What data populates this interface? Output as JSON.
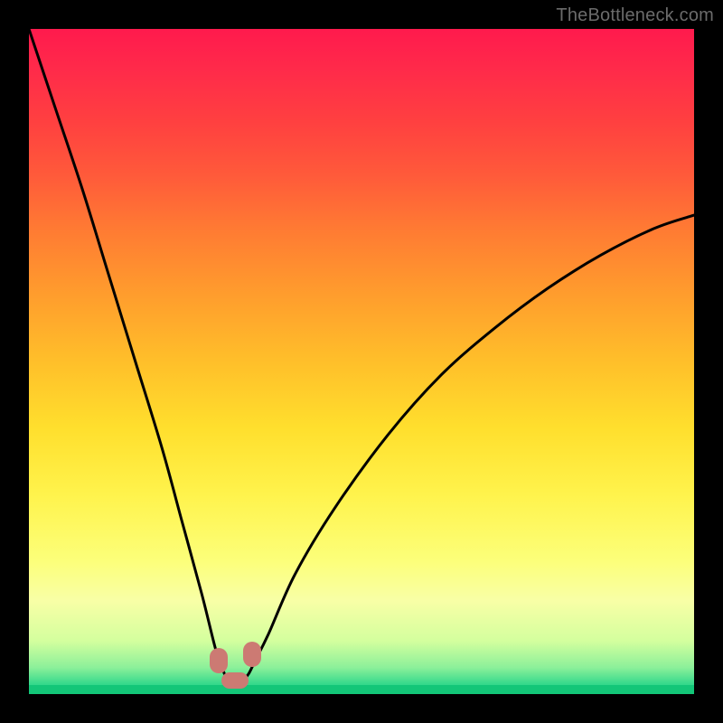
{
  "watermark": "TheBottleneck.com",
  "colors": {
    "frame": "#000000",
    "curve": "#000000",
    "marker": "#cc7a73",
    "watermark": "#6b6b6b",
    "gradient_top": "#ff1a4d",
    "gradient_bottom": "#18c97c"
  },
  "chart_data": {
    "type": "line",
    "title": "",
    "xlabel": "",
    "ylabel": "",
    "xlim": [
      0,
      100
    ],
    "ylim": [
      0,
      100
    ],
    "grid": false,
    "legend": false,
    "description": "Single V-shaped bottleneck curve on a vertical red→green gradient. Curve descends steeply from upper-left, reaches a flat minimum near x≈29–33 at y≈2, then rises with diminishing slope toward the right edge reaching y≈72 at x=100. No axes, ticks, or labels are rendered.",
    "series": [
      {
        "name": "bottleneck-curve",
        "x": [
          0,
          4,
          8,
          12,
          16,
          20,
          23,
          26,
          28,
          29,
          30,
          31,
          32,
          33,
          34,
          36,
          40,
          46,
          54,
          62,
          70,
          78,
          86,
          94,
          100
        ],
        "values": [
          100,
          88,
          76,
          63,
          50,
          37,
          26,
          15,
          7,
          4,
          2,
          2,
          2,
          3,
          5,
          9,
          18,
          28,
          39,
          48,
          55,
          61,
          66,
          70,
          72
        ]
      }
    ],
    "markers": [
      {
        "name": "min-left",
        "x": 28.5,
        "y": 5.0,
        "shape": "pill-v"
      },
      {
        "name": "min-mid",
        "x": 31.0,
        "y": 2.0,
        "shape": "pill-h"
      },
      {
        "name": "min-right",
        "x": 33.5,
        "y": 6.0,
        "shape": "pill-v"
      }
    ]
  }
}
